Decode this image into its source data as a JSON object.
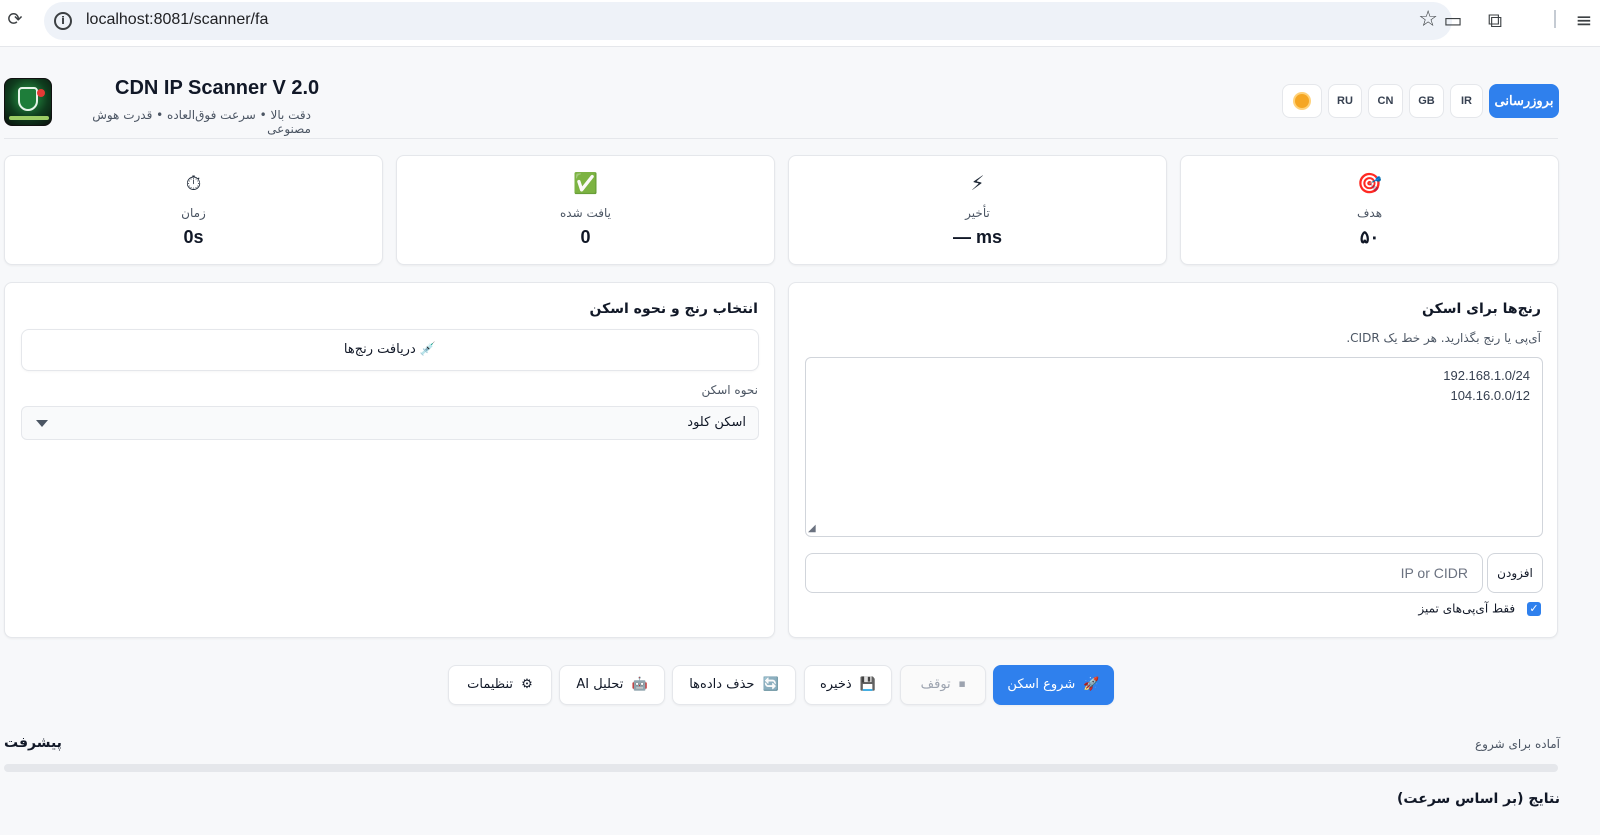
{
  "browser": {
    "url": "localhost:8081/scanner/fa"
  },
  "header": {
    "title": "CDN IP Scanner V 2.0",
    "subtitle": "دقت بالا • سرعت فوق‌العاده • قدرت هوش مصنوعی",
    "update_label": "بروزرسانی",
    "regions": [
      "IR",
      "GB",
      "CN",
      "RU"
    ],
    "theme_icon": "sun-icon"
  },
  "stats": [
    {
      "icon": "🎯",
      "icon_name": "target-icon",
      "label": "هدف",
      "value": "۵۰"
    },
    {
      "icon": "⚡",
      "icon_name": "lightning-icon",
      "label": "تأخیر",
      "value": "— ms"
    },
    {
      "icon": "✅",
      "icon_name": "check-icon",
      "label": "یافت شده",
      "value": "0"
    },
    {
      "icon": "⏱",
      "icon_name": "stopwatch-icon",
      "label": "زمان",
      "value": "0s"
    }
  ],
  "ranges_panel": {
    "title": "رنج‌ها برای اسکن",
    "hint": "آی‌پی یا رنج بگذارید. هر خط یک CIDR.",
    "ranges": [
      "192.168.1.0/24",
      "104.16.0.0/12"
    ],
    "input_placeholder": "IP or CIDR",
    "add_label": "افزودن",
    "clean_only_label": "فقط آی‌پی‌های تمیز",
    "clean_only_checked": true
  },
  "mode_panel": {
    "title": "انتخاب رنج و نحوه اسکن",
    "fetch_label": "دریافت رنج‌ها",
    "fetch_icon": "💉",
    "mode_label": "نحوه اسکن",
    "mode_value": "اسکن کلود"
  },
  "actions": {
    "start": {
      "icon": "🚀",
      "label": "شروع اسکن"
    },
    "stop": {
      "icon": "⏹",
      "label": "توقف"
    },
    "save": {
      "icon": "💾",
      "label": "ذخیره"
    },
    "clear": {
      "icon": "🔄",
      "label": "حذف داده‌ها"
    },
    "ai": {
      "icon": "🤖",
      "label": "تحلیل AI"
    },
    "settings": {
      "icon": "⚙",
      "label": "تنظیمات"
    }
  },
  "progress": {
    "title": "پیشرفت",
    "status": "آماده برای شروع",
    "percent": 0
  },
  "results": {
    "title": "نتایج (بر اساس سرعت)"
  },
  "colors": {
    "accent": "#2f80ed",
    "background": "#f7f8fa"
  }
}
